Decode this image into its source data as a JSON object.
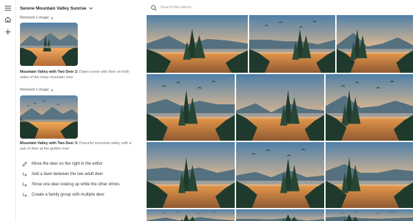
{
  "sidebar": {
    "icons": [
      "menu-icon",
      "home-icon",
      "plus-icon"
    ]
  },
  "album": {
    "title": "Serene Mountain Valley Sunrise",
    "dropdown_icon": "chevron-down-icon"
  },
  "remixes": [
    {
      "label": "Remixed 1 image",
      "title": "Mountain Valley with Two Deer 2:",
      "text": " Dawn scene with deer on both sides of the misty mountain river"
    },
    {
      "label": "Remixed 1 image",
      "title": "Mountain Valley with Two Deer 3:",
      "text": " Peaceful mountain valley with a pair of deer at the golden river"
    }
  ],
  "suggestions": [
    {
      "icon": "pencil-icon",
      "label": "Move the deer on the right in the editor"
    },
    {
      "icon": "reply-arrow-icon",
      "label": "Add a fawn between the two adult deer"
    },
    {
      "icon": "reply-arrow-icon",
      "label": "Show one deer looking up while the other drinks"
    },
    {
      "icon": "reply-arrow-icon",
      "label": "Create a family group with multiple deer"
    }
  ],
  "search": {
    "placeholder": "Search this album...",
    "icon": "search-icon"
  },
  "colors": {
    "sky_top": "#4e7fa8",
    "sky_glow": "#f2a24a",
    "mountain": "#55707e",
    "forest": "#1f3a2c",
    "water": "#e99a4b"
  }
}
